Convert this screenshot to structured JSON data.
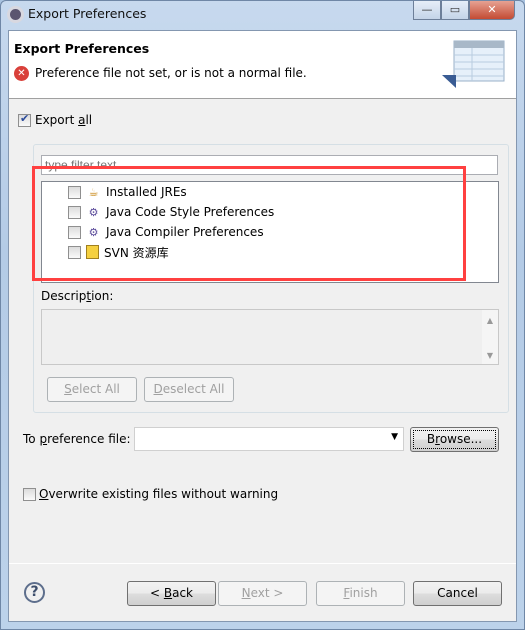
{
  "window": {
    "title": "Export Preferences",
    "controls": {
      "minimize": "—",
      "maximize": "▭",
      "close": "✕"
    }
  },
  "header": {
    "title": "Export Preferences",
    "message": "Preference file not set, or is not a normal file.",
    "message_icon": "error-icon"
  },
  "export_all": {
    "label_pre": "Export ",
    "label_accel": "a",
    "label_post": "ll",
    "checked": true
  },
  "filter": {
    "placeholder": "type filter text",
    "value": ""
  },
  "tree": {
    "items": [
      {
        "label": "Installed JREs",
        "icon": "jre-icon",
        "checked": false
      },
      {
        "label": "Java Code Style Preferences",
        "icon": "java-prefs-icon",
        "checked": false
      },
      {
        "label": "Java Compiler Preferences",
        "icon": "java-prefs-icon",
        "checked": false
      },
      {
        "label": "SVN 资源库",
        "icon": "svn-repository-icon",
        "checked": false
      }
    ]
  },
  "highlight_color": "#ff4040",
  "description": {
    "label_pre": "Descrip",
    "label_accel": "t",
    "label_post": "ion:",
    "value": ""
  },
  "buttons": {
    "select_all": {
      "accel": "S",
      "rest": "elect All"
    },
    "deselect_all": {
      "accel": "D",
      "rest": "eselect All"
    },
    "browse": {
      "pre": "B",
      "accel": "r",
      "post": "owse..."
    },
    "back": {
      "pre": "< ",
      "accel": "B",
      "post": "ack"
    },
    "next": {
      "accel": "N",
      "post": "ext >"
    },
    "finish": {
      "accel": "F",
      "post": "inish"
    },
    "cancel": "Cancel"
  },
  "to_file": {
    "label_pre": "To ",
    "label_accel": "p",
    "label_post": "reference file:",
    "value": ""
  },
  "overwrite": {
    "accel": "O",
    "rest": "verwrite existing files without warning",
    "checked": false
  },
  "help": "?"
}
